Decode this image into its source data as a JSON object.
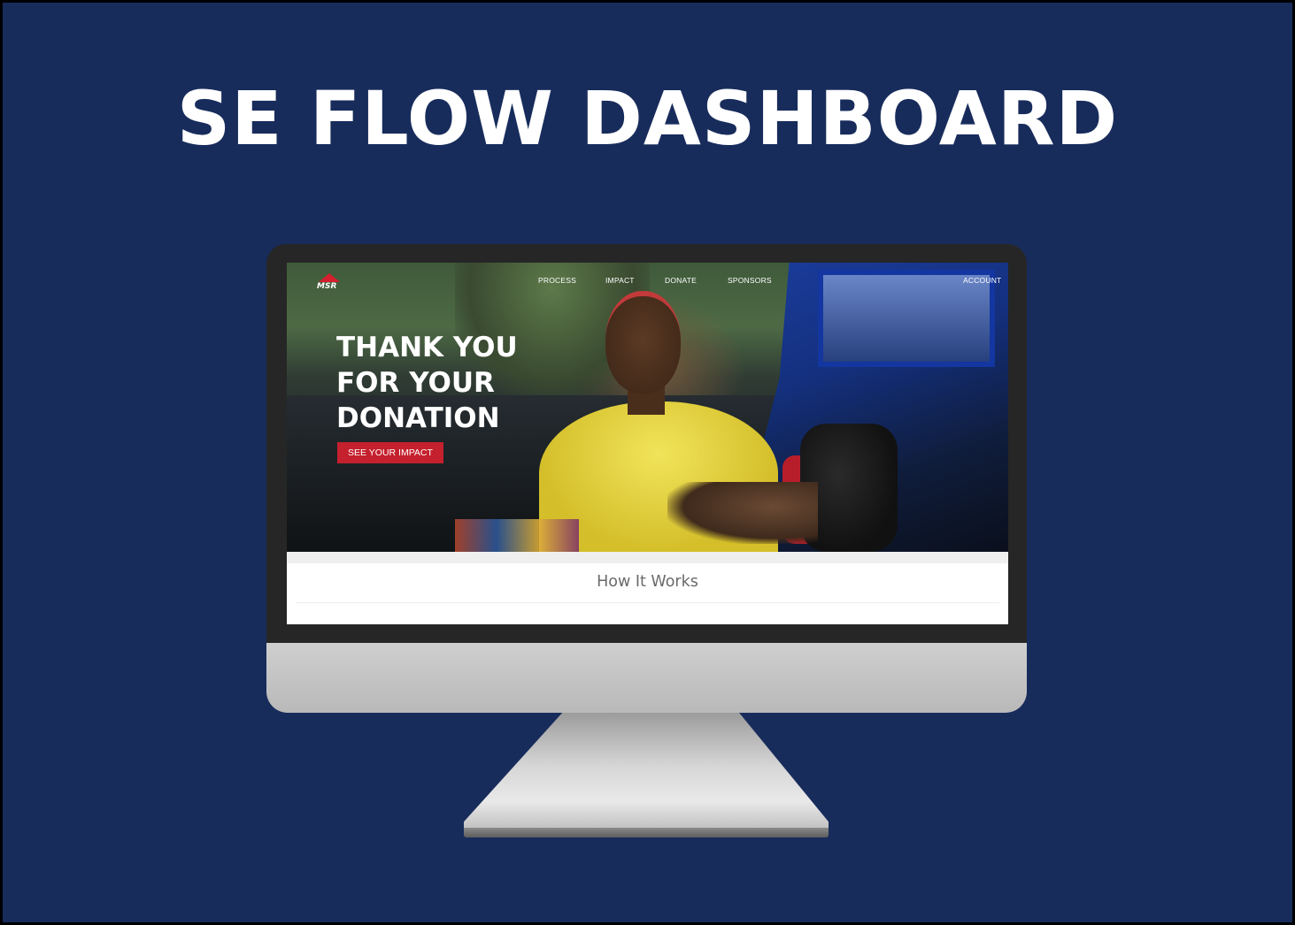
{
  "headline": "SE FLOW DASHBOARD",
  "site": {
    "logo_text": "MSR",
    "nav": {
      "process": "PROCESS",
      "impact": "IMPACT",
      "donate": "DONATE",
      "sponsors": "SPONSORS",
      "account": "ACCOUNT"
    },
    "hero": {
      "title_lines": [
        "THANK YOU",
        "FOR YOUR",
        "DONATION"
      ],
      "cta": "SEE YOUR IMPACT"
    },
    "section_title": "How It Works"
  },
  "colors": {
    "background": "#182c5c",
    "accent_red": "#c5202d",
    "bezel": "#262626",
    "stand": "#c4c4c4"
  },
  "icons": {
    "logo": "msr-logo-icon"
  }
}
